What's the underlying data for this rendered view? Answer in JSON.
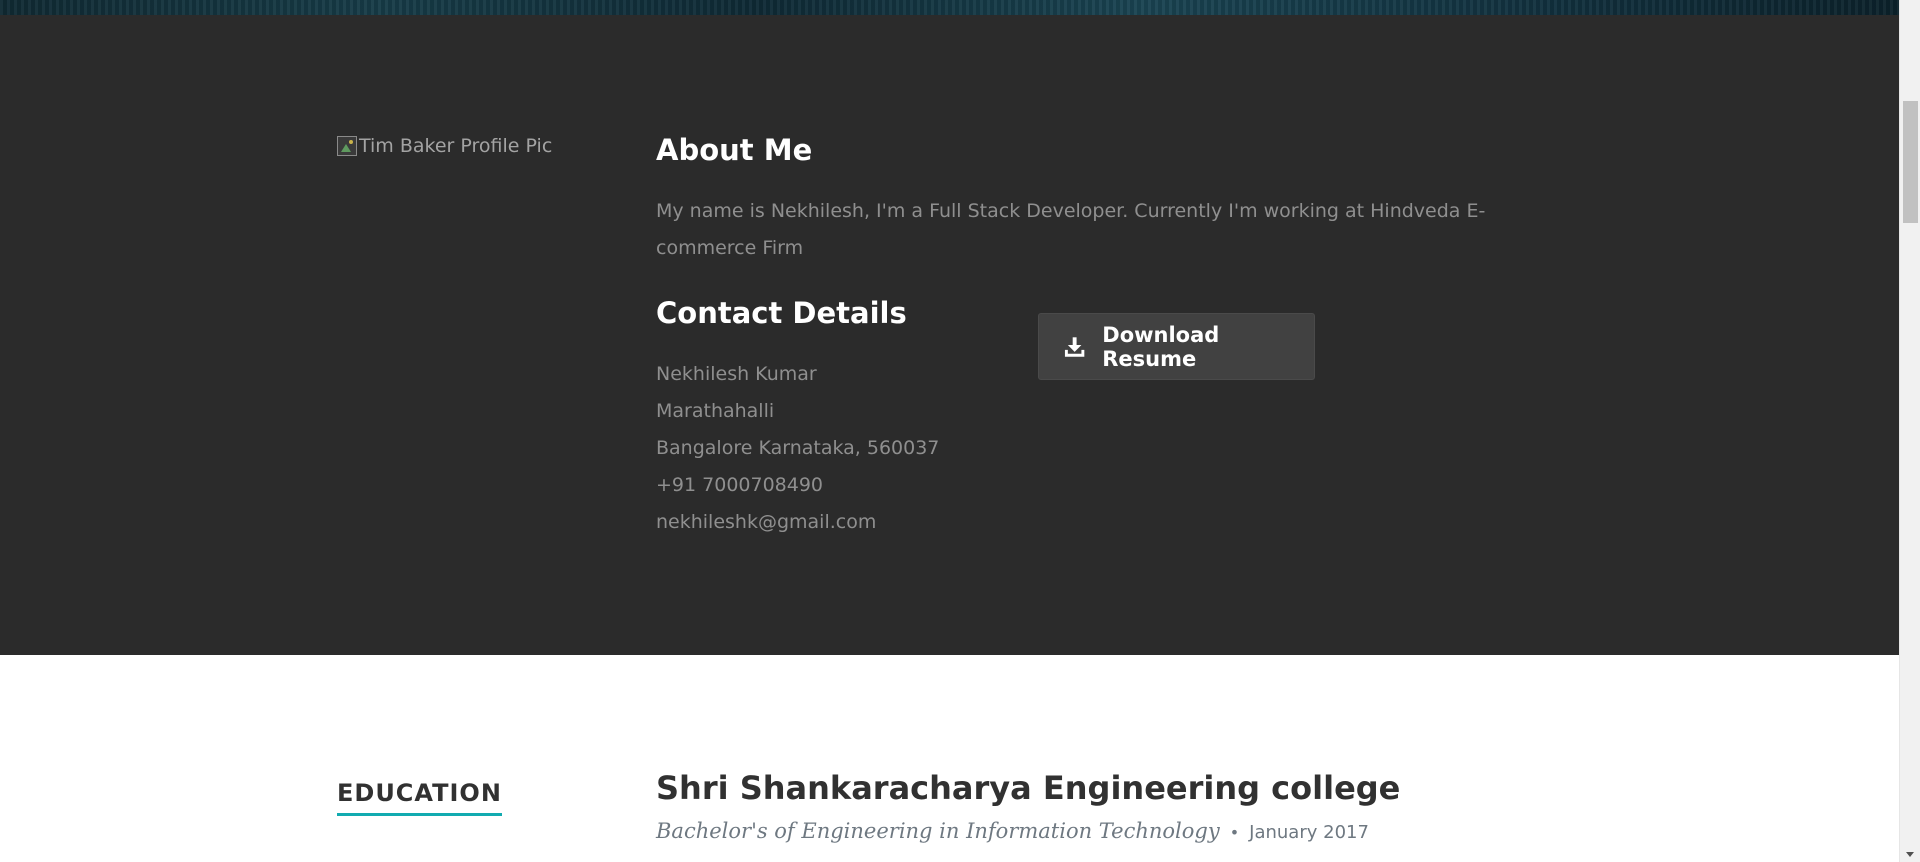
{
  "about": {
    "profile_pic_alt": "Tim Baker Profile Pic",
    "title": "About Me",
    "text": "My name is Nekhilesh, I'm a Full Stack Developer. Currently I'm working at Hindveda E-commerce Firm"
  },
  "contact": {
    "title": "Contact Details",
    "lines": [
      "Nekhilesh Kumar",
      "Marathahalli",
      "Bangalore Karnataka, 560037",
      "+91 7000708490",
      "nekhileshk@gmail.com"
    ]
  },
  "download_button": {
    "label": "Download Resume",
    "icon": "download-icon"
  },
  "education": {
    "heading": "EDUCATION",
    "school": "Shri Shankaracharya Engineering college",
    "degree": "Bachelor's of Engineering in Information Technology",
    "date_separator": "•",
    "date": "January 2017",
    "accent_color": "#11abb0"
  },
  "colors": {
    "about_background": "#2b2b2b",
    "button_background": "#414141",
    "muted_text": "#8f8f8f"
  }
}
